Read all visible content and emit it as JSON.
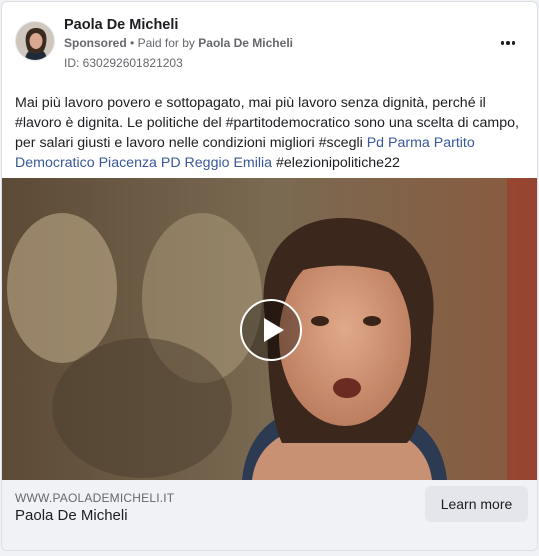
{
  "post": {
    "page_name": "Paola De Micheli",
    "sponsored_label": "Sponsored",
    "paid_for_prefix": "Paid for by",
    "paid_for_name": "Paola De Micheli",
    "ad_id": "ID: 630292601821203",
    "more_icon": "more-horizontal-icon"
  },
  "body": {
    "segments": [
      {
        "text": "Mai più lavoro povero e sottopagato, mai più lavoro senza dignità, perché il #lavoro è dignita. Le politiche del #partitodemocratico sono una scelta di campo, per salari giusti e lavoro nelle condizioni migliori #scegli ",
        "link": false
      },
      {
        "text": "Pd Parma",
        "link": true
      },
      {
        "text": " ",
        "link": false
      },
      {
        "text": "Partito Democratico Piacenza",
        "link": true
      },
      {
        "text": " ",
        "link": false
      },
      {
        "text": "PD Reggio Emilia",
        "link": true
      },
      {
        "text": " #elezionipolitiche22",
        "link": false
      }
    ]
  },
  "media": {
    "type": "video",
    "play_icon": "play-icon"
  },
  "footer": {
    "domain": "WWW.PAOLADEMICHELI.IT",
    "title": "Paola De Micheli",
    "cta_label": "Learn more"
  },
  "colors": {
    "link": "#385898",
    "secondary_text": "#65676b",
    "footer_bg": "#f0f2f5",
    "button_bg": "#e4e6eb"
  }
}
